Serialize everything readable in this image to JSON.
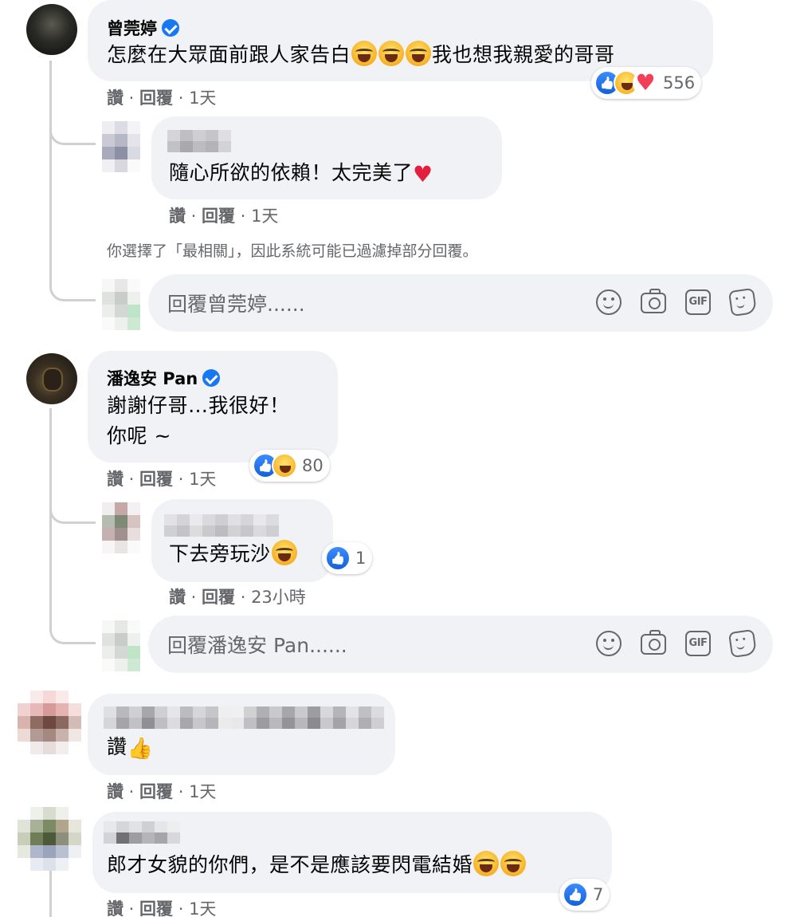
{
  "comments": [
    {
      "author": "曾莞婷",
      "verified": true,
      "text_before_emoji": "怎麼在大眾面前跟人家告白",
      "text_after_emoji": "我也想我親愛的哥哥",
      "reactions_count": "556",
      "actions": {
        "like": "讚",
        "reply": "回覆",
        "time": "1天"
      },
      "replies": [
        {
          "author": "",
          "text": "隨心所欲的依賴！太完美了",
          "actions": {
            "like": "讚",
            "reply": "回覆",
            "time": "1天"
          }
        }
      ],
      "filter_notice": "你選擇了「最相關」，因此系統可能已過濾掉部分回覆。",
      "reply_placeholder": "回覆曾莞婷......"
    },
    {
      "author": "潘逸安 Pan",
      "verified": true,
      "text_line1": "謝謝仔哥…我很好！",
      "text_line2": "你呢 ~",
      "reactions_count": "80",
      "actions": {
        "like": "讚",
        "reply": "回覆",
        "time": "1天"
      },
      "replies": [
        {
          "author": "",
          "text": "下去旁玩沙",
          "reactions_count": "1",
          "actions": {
            "like": "讚",
            "reply": "回覆",
            "time": "23小時"
          }
        }
      ],
      "reply_placeholder": "回覆潘逸安 Pan......"
    },
    {
      "author": "",
      "text": "讚",
      "actions": {
        "like": "讚",
        "reply": "回覆",
        "time": "1天"
      }
    },
    {
      "author": "",
      "text": "郎才女貌的你們，是不是應該要閃電結婚",
      "reactions_count": "7",
      "actions": {
        "like": "讚",
        "reply": "回覆",
        "time": "1天"
      }
    }
  ],
  "input_tools": [
    "smile-icon",
    "camera-icon",
    "gif-icon",
    "sticker-icon"
  ],
  "gif_label": "GIF",
  "separator": " · ",
  "colors": {
    "bubble": "#f0f2f5",
    "secondary_text": "#65676b",
    "like_blue": "#1877f2",
    "love_red": "#f33e58"
  }
}
